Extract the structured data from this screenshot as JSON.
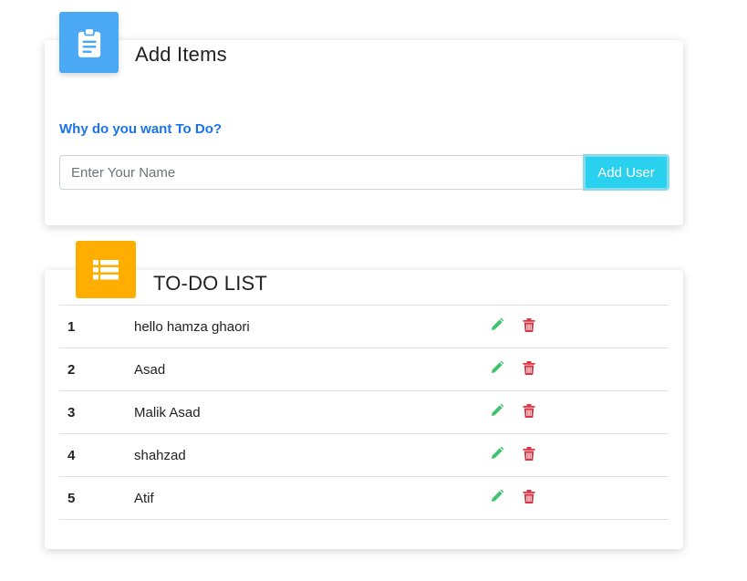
{
  "add_card": {
    "title": "Add Items",
    "question": "Why do you want To Do?",
    "input_placeholder": "Enter Your Name",
    "input_value": "",
    "button_label": "Add User",
    "icon": "clipboard-icon",
    "icon_tile_color": "#4aa8f5"
  },
  "list_card": {
    "title": "TO-DO LIST",
    "icon": "list-icon",
    "icon_tile_color": "#ffae00",
    "rows": [
      {
        "num": "1",
        "name": "hello hamza ghaori"
      },
      {
        "num": "2",
        "name": "Asad"
      },
      {
        "num": "3",
        "name": "Malik Asad"
      },
      {
        "num": "4",
        "name": "shahzad"
      },
      {
        "num": "5",
        "name": "Atif"
      }
    ],
    "row_actions": {
      "edit_icon": "pencil-icon",
      "edit_color": "#3ec46d",
      "delete_icon": "trash-icon",
      "delete_color": "#dc3545"
    }
  },
  "colors": {
    "accent_blue": "#1a73e8",
    "button_cyan": "#2ad1ee"
  }
}
